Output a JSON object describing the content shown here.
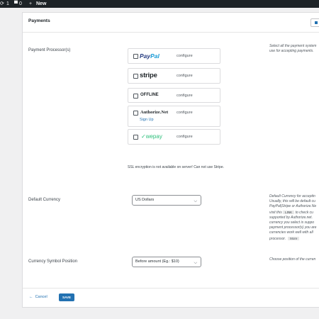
{
  "adminbar": {
    "updates_count": "1",
    "comments_count": "0",
    "new_label": "New"
  },
  "card": {
    "title": "Payments"
  },
  "processors": {
    "label": "Payment Processor(s)",
    "help_line1": "Select all the payment system",
    "help_line2": "use for accepting payments.",
    "items": [
      {
        "name": "PayPal",
        "logo_part1": "Pay",
        "logo_part2": "Pal",
        "action": "configure",
        "checked": false
      },
      {
        "name": "stripe",
        "action": "configure",
        "checked": false
      },
      {
        "name": "OFFLINE",
        "action": "configure",
        "checked": false
      },
      {
        "name": "Authorize.Net",
        "action": "configure",
        "extra_link": "Sign Up",
        "checked": false
      },
      {
        "name": "wepay",
        "action": "configure",
        "checked": false
      }
    ],
    "ssl_notice": "SSL encryption is not available on server! Can not use Stripe."
  },
  "currency": {
    "label": "Default Currency",
    "value": "US Dollars",
    "help_lines": [
      "Default Currency for acceptin",
      "Usually, this will be default cu",
      "PayPal|Stripe or Authorize.Ne",
      "supported by Authorize.net. ",
      "currency you select is suppo",
      "payment processor(s) you are",
      "currencies work well with all ",
      "processor."
    ],
    "help_visit": "visit this",
    "help_link": "LINK",
    "help_after_link": "to check cu",
    "more_label": "More"
  },
  "symbol_position": {
    "label": "Currency Symbol Position",
    "value": "Before amount (Eg.: $10)",
    "help": "Choose position of the curren"
  },
  "footer": {
    "cancel_label": "Cancel",
    "save_label": "SAVE"
  },
  "colors": {
    "adminbar": "#1d2327",
    "accent": "#2271b1",
    "paypal_dark": "#253b80",
    "paypal_light": "#179bd7",
    "wepay": "#2cbf7a"
  }
}
